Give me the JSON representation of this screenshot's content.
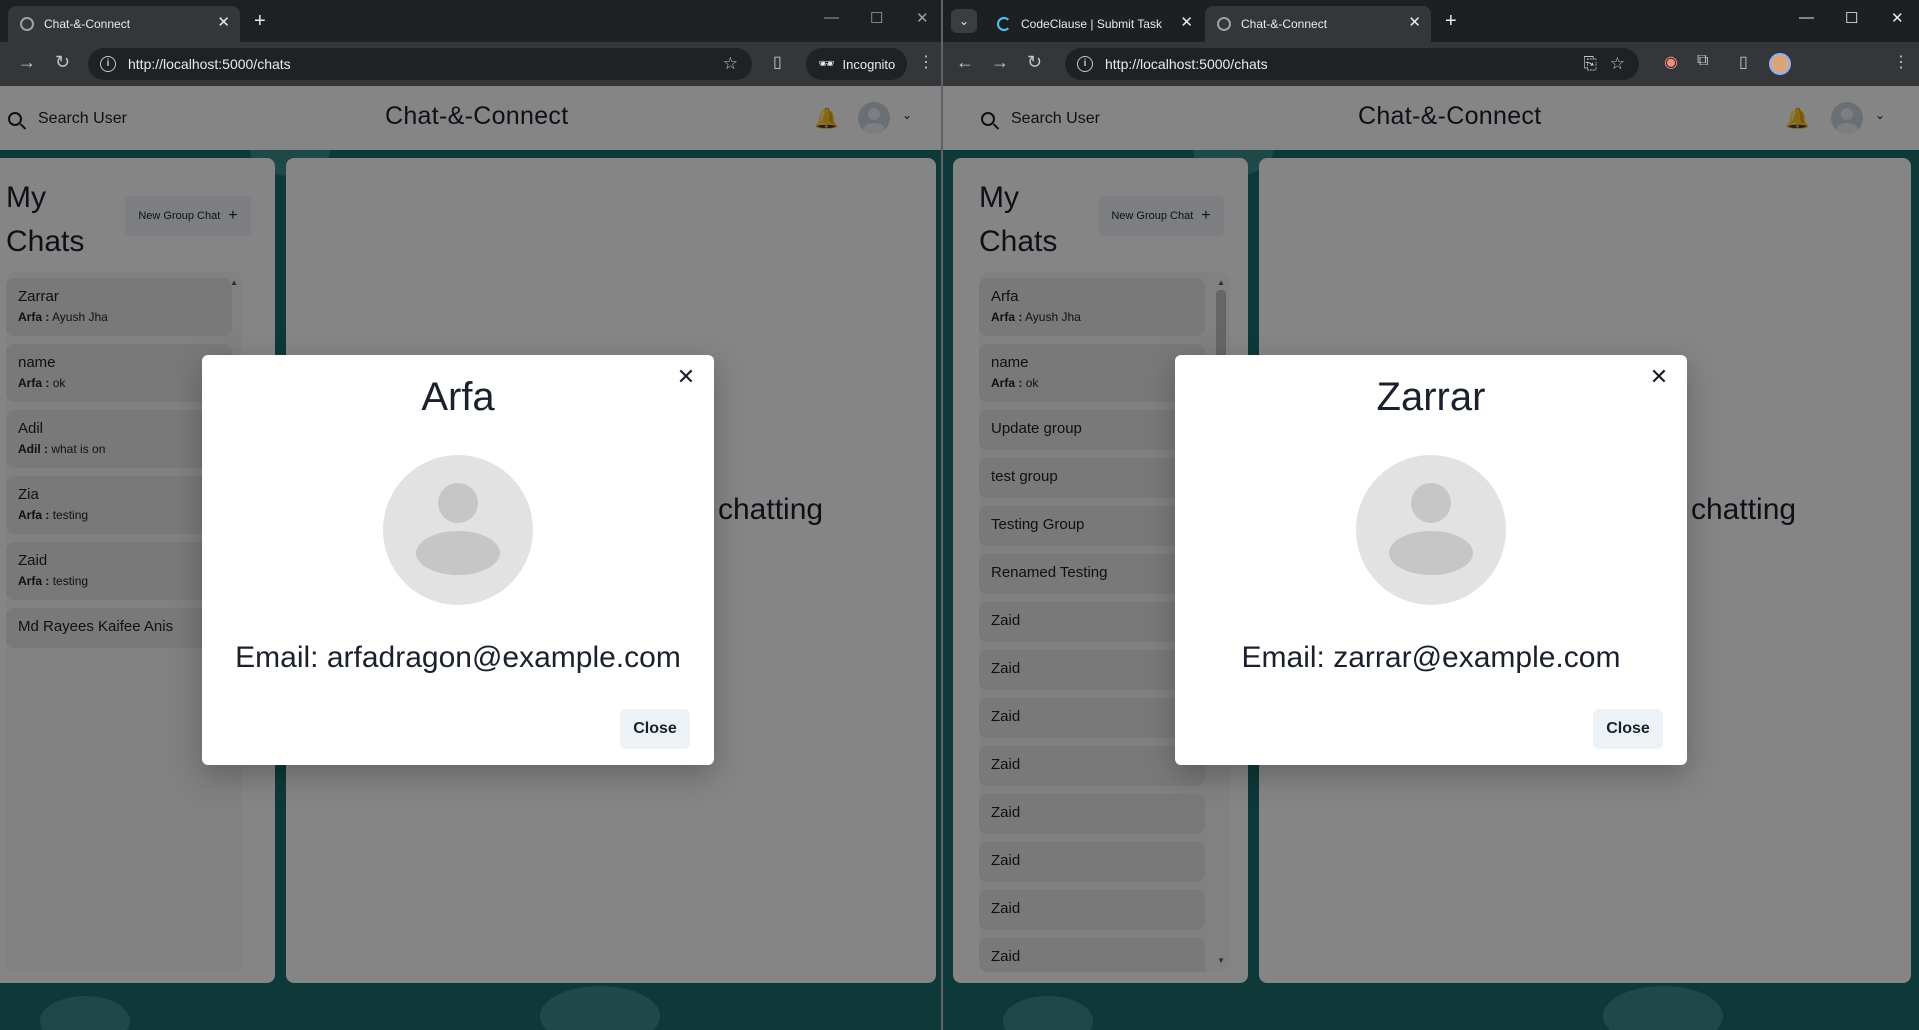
{
  "left_window": {
    "tabs": [
      {
        "title": "Chat-&-Connect",
        "active": true
      }
    ],
    "url": "http://localhost:5000/chats",
    "incognito_label": "Incognito",
    "app": {
      "search_label": "Search User",
      "brand": "Chat-&-Connect",
      "my_chats_title": "My Chats",
      "new_group_label": "New Group Chat",
      "chats": [
        {
          "name": "Zarrar",
          "sender": "Arfa :",
          "message": "Ayush Jha"
        },
        {
          "name": "name",
          "sender": "Arfa :",
          "message": "ok"
        },
        {
          "name": "Adil",
          "sender": "Adil :",
          "message": "what is on"
        },
        {
          "name": "Zia",
          "sender": "Arfa :",
          "message": "testing"
        },
        {
          "name": "Zaid",
          "sender": "Arfa :",
          "message": "testing"
        },
        {
          "name": "Md Rayees Kaifee Anis",
          "sender": "",
          "message": ""
        }
      ],
      "start_chatting_text": "chatting"
    },
    "modal": {
      "title": "Arfa",
      "email_text": "Email: arfadragon@example.com",
      "close_button": "Close"
    }
  },
  "right_window": {
    "tabs": [
      {
        "title": "CodeClause | Submit Task",
        "active": false
      },
      {
        "title": "Chat-&-Connect",
        "active": true
      }
    ],
    "url": "http://localhost:5000/chats",
    "app": {
      "search_label": "Search User",
      "brand": "Chat-&-Connect",
      "my_chats_title": "My Chats",
      "new_group_label": "New Group Chat",
      "chats": [
        {
          "name": "Arfa",
          "sender": "Arfa :",
          "message": "Ayush Jha"
        },
        {
          "name": "name",
          "sender": "Arfa :",
          "message": "ok"
        },
        {
          "name": "Update group",
          "sender": "",
          "message": ""
        },
        {
          "name": "test group",
          "sender": "",
          "message": ""
        },
        {
          "name": "Testing Group",
          "sender": "",
          "message": ""
        },
        {
          "name": "Renamed Testing",
          "sender": "",
          "message": ""
        },
        {
          "name": "Zaid",
          "sender": "",
          "message": ""
        },
        {
          "name": "Zaid",
          "sender": "",
          "message": ""
        },
        {
          "name": "Zaid",
          "sender": "",
          "message": ""
        },
        {
          "name": "Zaid",
          "sender": "",
          "message": ""
        },
        {
          "name": "Zaid",
          "sender": "",
          "message": ""
        },
        {
          "name": "Zaid",
          "sender": "",
          "message": ""
        },
        {
          "name": "Zaid",
          "sender": "",
          "message": ""
        },
        {
          "name": "Zaid",
          "sender": "",
          "message": ""
        }
      ],
      "start_chatting_text": "chatting"
    },
    "modal": {
      "title": "Zarrar",
      "email_text": "Email: zarrar@example.com",
      "close_button": "Close"
    }
  },
  "icons": {
    "search": "search-icon",
    "bell": "bell-icon",
    "close": "close-icon",
    "plus": "plus-icon",
    "avatar": "user-avatar-icon"
  },
  "colors": {
    "overlay": "#000000",
    "background_teal": "#1d6b6b",
    "modal_bg": "#ffffff",
    "button_bg": "#edf2f7"
  }
}
